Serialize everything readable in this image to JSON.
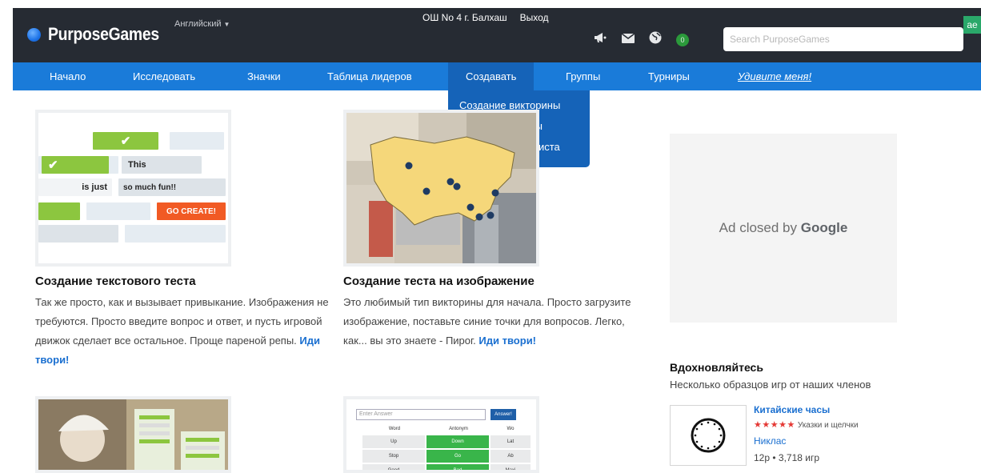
{
  "header": {
    "logo_text": "PurposeGames",
    "language": "Английский",
    "user_school": "ОШ No 4 г. Балхаш",
    "logout": "Выход",
    "search_placeholder": "Search PurposeGames",
    "notifications_count": "0",
    "corner_badge": "ae"
  },
  "nav": {
    "items": [
      {
        "label": "Начало"
      },
      {
        "label": "Исследовать"
      },
      {
        "label": "Значки"
      },
      {
        "label": "Таблица лидеров"
      },
      {
        "label": "Создавать"
      },
      {
        "label": "Группы"
      },
      {
        "label": "Турниры"
      },
      {
        "label": "Удивите меня!"
      }
    ],
    "active": "Создавать"
  },
  "dropdown": {
    "items": [
      {
        "label": "Создание викторины"
      },
      {
        "label": "Создание группы"
      },
      {
        "label": "Создание плейлиста"
      }
    ]
  },
  "cards": [
    {
      "title": "Создание текстового теста",
      "text": "Так же просто, как и вызывает привыкание. Изображения не требуются. Просто введите вопрос и ответ, и пусть игровой движок сделает все остальное. Проще пареной репы.",
      "link": "Иди твори!",
      "thumb": {
        "word1": "This",
        "word2": "is just",
        "word3": "so much fun!!",
        "cta": "GO CREATE!"
      }
    },
    {
      "title": "Создание теста на изображение",
      "text": "Это любимый тип викторины для начала. Просто загрузите изображение, поставьте синие точки для вопросов. Легко, как... вы это знаете - Пирог.",
      "link": "Иди твори!"
    }
  ],
  "antonym_thumb": {
    "placeholder": "Enter Answer",
    "button": "Answer!",
    "headers": [
      "Word",
      "Antonym",
      "Wo"
    ],
    "rows": [
      [
        "Up",
        "Down",
        "Lat"
      ],
      [
        "Stop",
        "Go",
        "Ab"
      ],
      [
        "Good",
        "Bad",
        "Maxi"
      ]
    ]
  },
  "ad": {
    "text": "Ad closed by",
    "brand": "Google"
  },
  "inspiration": {
    "title": "Вдохновляйтесь",
    "subtitle": "Несколько образцов игр от наших членов",
    "game": {
      "name": "Китайские часы",
      "stars": "★★★★★",
      "tags": "Указки и щелчки",
      "author": "Никлас",
      "meta": "12р • 3,718 игр"
    }
  },
  "colors": {
    "topbar": "#262b33",
    "nav": "#1a7bd9",
    "nav_active": "#1563b8",
    "link": "#1a6fd0",
    "green": "#8cc63f",
    "orange": "#f15a24"
  }
}
